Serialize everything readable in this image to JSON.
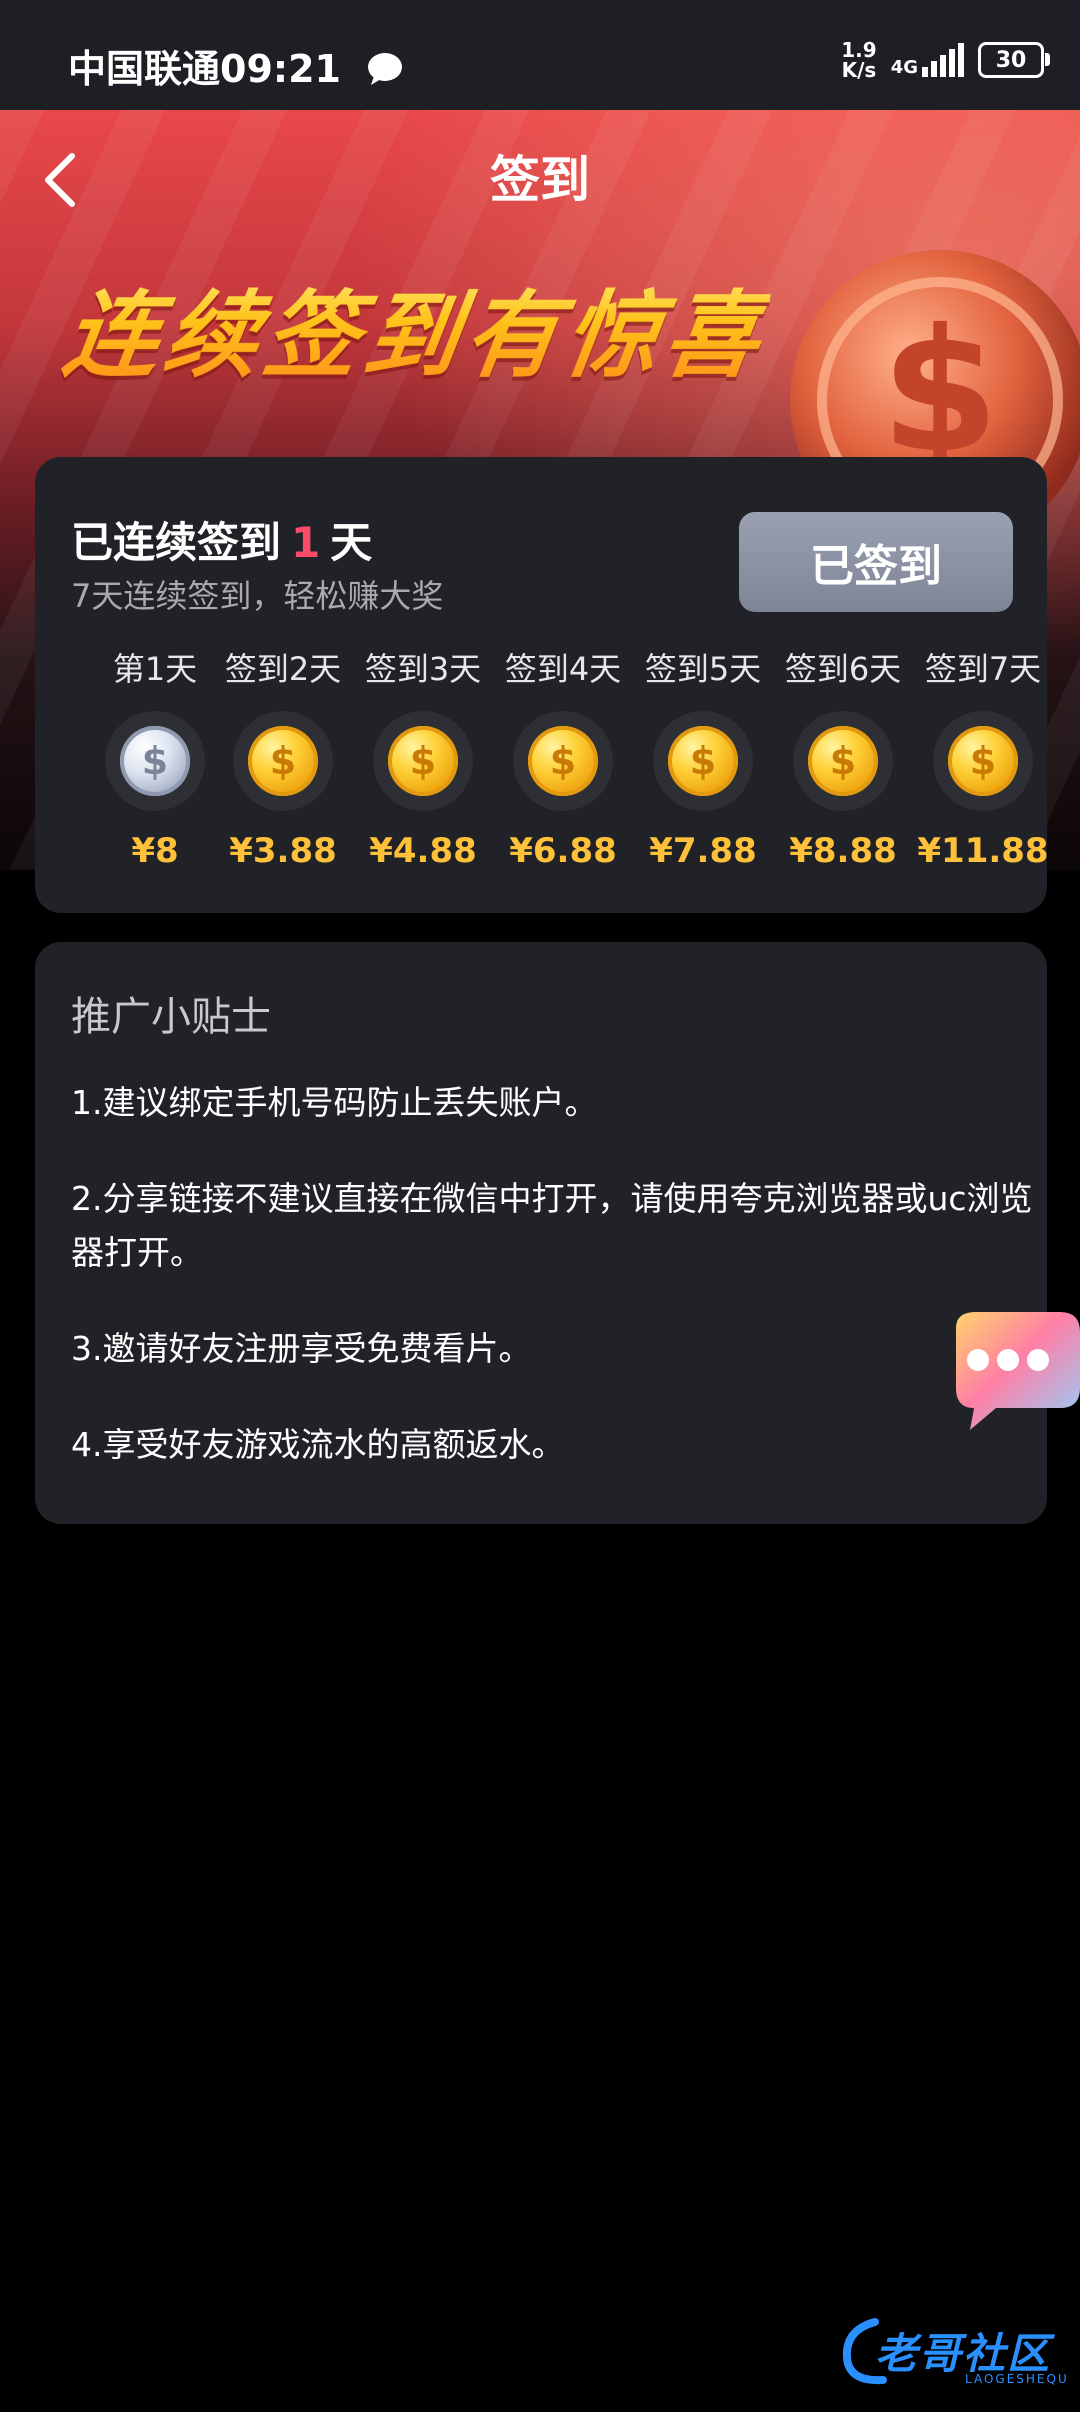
{
  "status_bar": {
    "carrier": "中国联通",
    "time": "09:21",
    "speed_value": "1.9",
    "speed_unit": "K/s",
    "network": "4G",
    "battery": "30"
  },
  "header": {
    "title": "签到",
    "headline": "连续签到有惊喜"
  },
  "checkin": {
    "streak_prefix": "已连续签到",
    "streak_days": "1",
    "streak_suffix": "天",
    "subtitle": "7天连续签到，轻松赚大奖",
    "button_label": "已签到",
    "days": [
      {
        "label": "第1天",
        "reward": "¥8",
        "claimed": true
      },
      {
        "label": "签到2天",
        "reward": "¥3.88",
        "claimed": false
      },
      {
        "label": "签到3天",
        "reward": "¥4.88",
        "claimed": false
      },
      {
        "label": "签到4天",
        "reward": "¥6.88",
        "claimed": false
      },
      {
        "label": "签到5天",
        "reward": "¥7.88",
        "claimed": false
      },
      {
        "label": "签到6天",
        "reward": "¥8.88",
        "claimed": false
      },
      {
        "label": "签到7天",
        "reward": "¥11.88",
        "claimed": false
      }
    ]
  },
  "tips": {
    "title": "推广小贴士",
    "items": [
      "1.建议绑定手机号码防止丢失账户。",
      "2.分享链接不建议直接在微信中打开，请使用夸克浏览器或uc浏览器打开。",
      "3.邀请好友注册享受免费看片。",
      "4.享受好友游戏流水的高额返水。"
    ]
  },
  "watermark": {
    "text": "老哥社区",
    "sub": "LAOGESHEQU"
  },
  "colors": {
    "accent_red": "#ff4b6a",
    "reward_gold": "#ffc13a",
    "card_bg": "#202227",
    "button_bg": "#8a91a3"
  },
  "icons": {
    "back": "chevron-left-icon",
    "chat": "chat-bubble-icon",
    "coin": "dollar-coin-icon"
  }
}
